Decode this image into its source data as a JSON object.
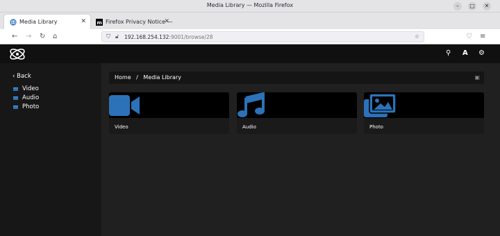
{
  "window": {
    "title": "Media Library — Mozilla Firefox"
  },
  "tabs": [
    {
      "label": "Media Library",
      "icon": "globe-icon"
    },
    {
      "label": "Firefox Privacy Notice —",
      "icon": "mozilla-icon"
    }
  ],
  "navbar": {
    "url_host": "192.168.254.132",
    "url_path": ":9001/browse/28"
  },
  "sidebar": {
    "back_label": "Back",
    "items": [
      {
        "label": "Video"
      },
      {
        "label": "Audio"
      },
      {
        "label": "Photo"
      }
    ]
  },
  "breadcrumb": {
    "home": "Home",
    "separator": "/",
    "current": "Media Library"
  },
  "cards": [
    {
      "label": "Video",
      "icon": "video-camera-icon"
    },
    {
      "label": "Audio",
      "icon": "music-note-icon"
    },
    {
      "label": "Photo",
      "icon": "photos-icon"
    }
  ],
  "colors": {
    "accent": "#2c72b8",
    "app_bar": "#101010",
    "sidebar": "#171717",
    "main": "#202020"
  }
}
